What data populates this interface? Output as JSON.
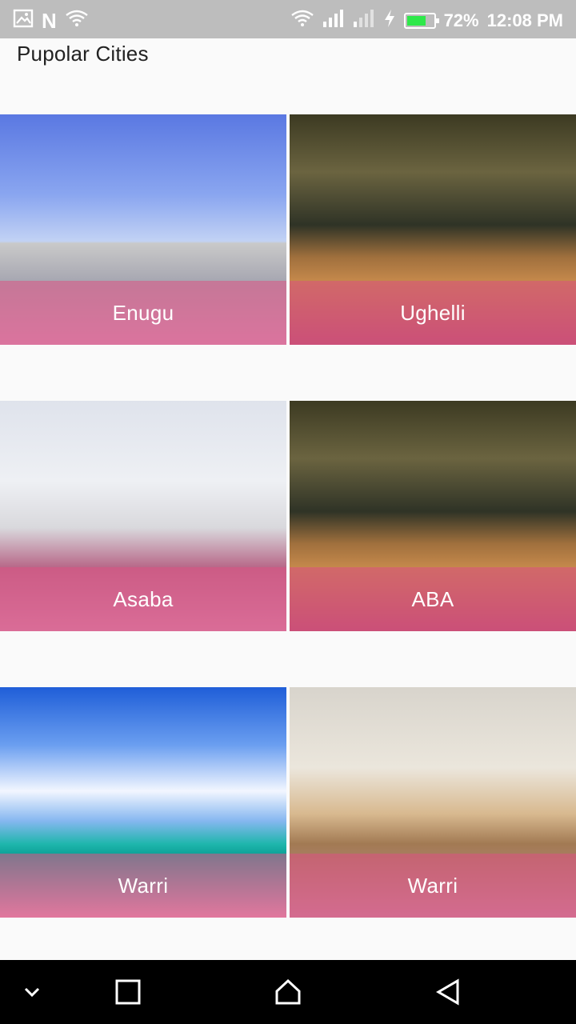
{
  "status_bar": {
    "battery_percent": "72%",
    "time": "12:08 PM",
    "battery_level": 0.72,
    "left_icons": [
      "image-icon",
      "n-icon",
      "wifi-question-icon"
    ],
    "right_icons": [
      "wifi-icon",
      "signal-icon",
      "signal-weak-icon",
      "charging-icon",
      "battery-icon"
    ],
    "n_glyph": "N"
  },
  "page": {
    "title": "Pupolar Cities"
  },
  "cities": [
    {
      "name": "Enugu",
      "scene": "street"
    },
    {
      "name": "Ughelli",
      "scene": "house"
    },
    {
      "name": "Asaba",
      "scene": "kitchen"
    },
    {
      "name": "ABA",
      "scene": "house"
    },
    {
      "name": "Warri",
      "scene": "beach"
    },
    {
      "name": "Warri",
      "scene": "living"
    }
  ],
  "nav_bar": {
    "buttons": [
      "chevron-down-icon",
      "recents-icon",
      "home-icon",
      "back-icon"
    ]
  },
  "colors": {
    "status_bar": "#bdbdbd",
    "overlay": "#dc5082",
    "nav_bar": "#000000",
    "battery_fill": "#2ee84a"
  }
}
